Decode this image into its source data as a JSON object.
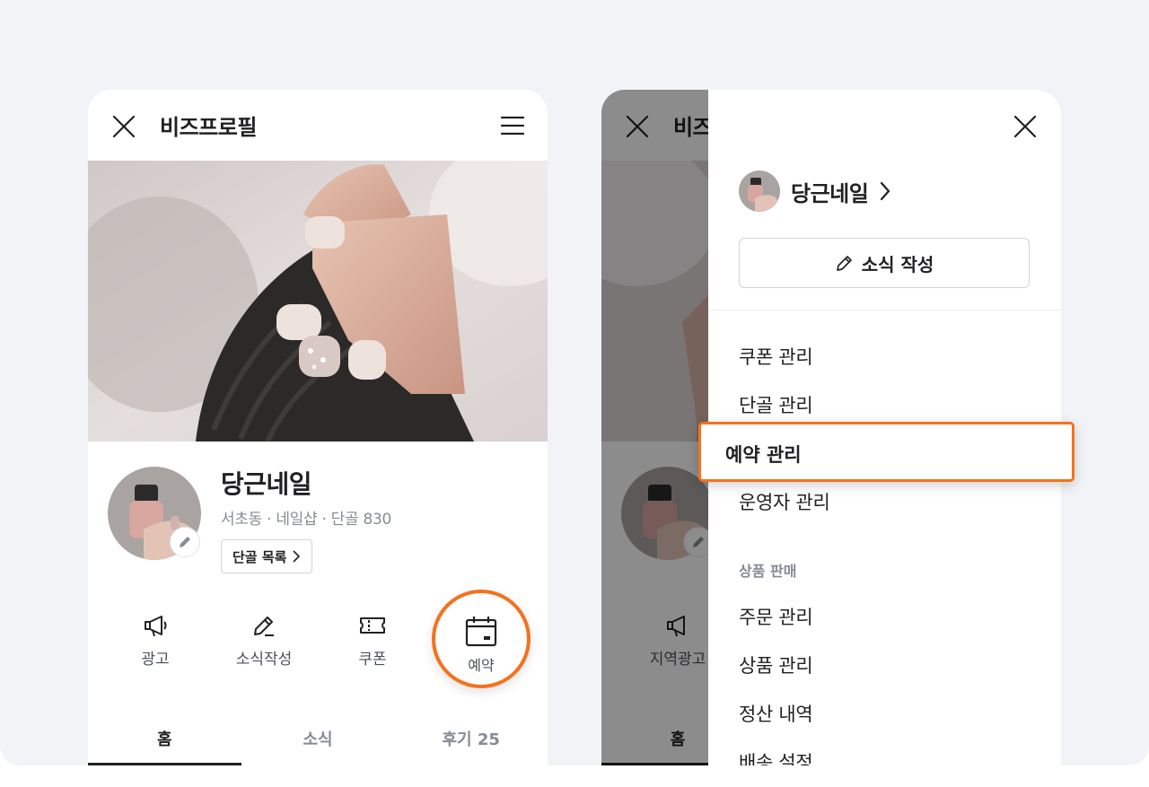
{
  "left_screen": {
    "appbar": {
      "title": "비즈프로필",
      "close_icon": "close-icon",
      "menu_icon": "hamburger-icon"
    },
    "profile": {
      "name": "당근네일",
      "meta": "서초동 · 네일샵 · 단골 830",
      "regulars_button": "단골 목록"
    },
    "actions": [
      {
        "label": "광고",
        "icon": "megaphone-icon"
      },
      {
        "label": "소식작성",
        "icon": "pencil-icon"
      },
      {
        "label": "쿠폰",
        "icon": "ticket-icon"
      },
      {
        "label": "예약",
        "icon": "calendar-icon"
      }
    ],
    "tabs": [
      "홈",
      "소식",
      "후기 25"
    ]
  },
  "right_screen": {
    "appbar": {
      "title": "비즈"
    },
    "behind": {
      "action_label": "지역광고",
      "tab_label": "홈"
    },
    "drawer": {
      "business_name": "당근네일",
      "write_button": "소식 작성",
      "menu_items": [
        "쿠폰 관리",
        "단골 관리",
        "예약 관리",
        "운영자 관리"
      ],
      "section_label": "상품 판매",
      "section_items": [
        "주문 관리",
        "상품 관리",
        "정산 내역",
        "배송 설정"
      ]
    }
  },
  "colors": {
    "accent": "#f6711c",
    "background": "#f2f3f6",
    "text": "#212124",
    "muted": "#868b94"
  }
}
